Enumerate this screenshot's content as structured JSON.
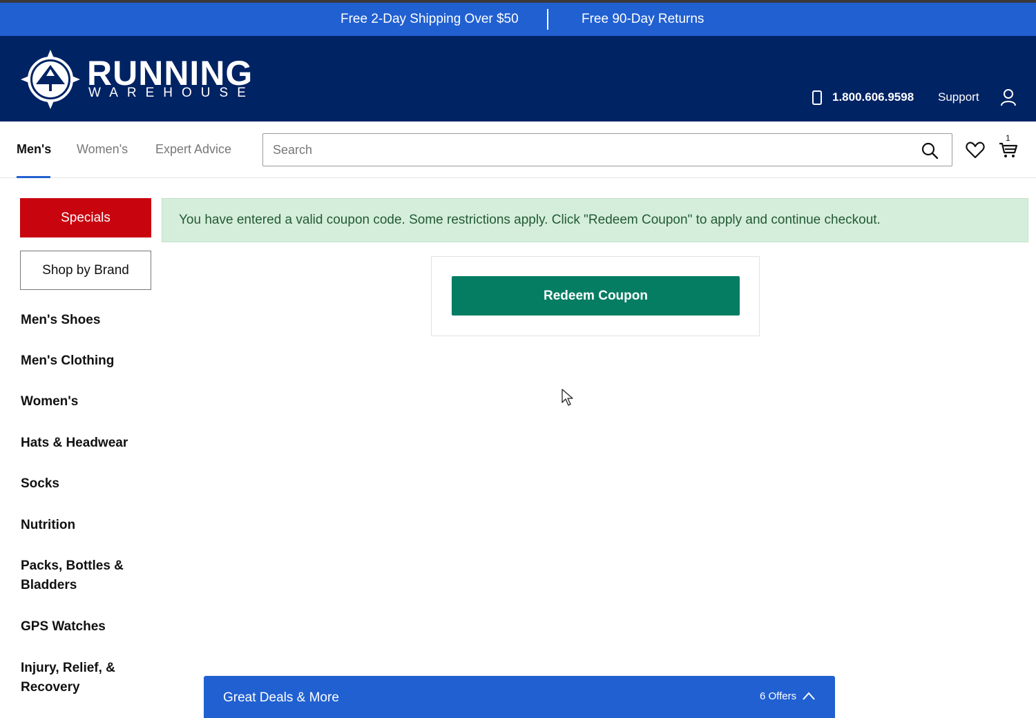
{
  "promo": {
    "left": "Free 2-Day Shipping Over $50",
    "right": "Free 90-Day Returns"
  },
  "header": {
    "logo_word": "RUNNING",
    "logo_sub": "WAREHOUSE",
    "phone": "1.800.606.9598",
    "support": "Support"
  },
  "nav": {
    "tabs": [
      {
        "label": "Men's",
        "active": true
      },
      {
        "label": "Women's",
        "active": false
      },
      {
        "label": "Expert Advice",
        "active": false
      }
    ],
    "search_placeholder": "Search",
    "cart_count": "1"
  },
  "sidebar": {
    "specials_label": "Specials",
    "brand_label": "Shop by Brand",
    "items": [
      {
        "label": "Men's Shoes"
      },
      {
        "label": "Men's Clothing"
      },
      {
        "label": "Women's"
      },
      {
        "label": "Hats & Headwear"
      },
      {
        "label": "Socks"
      },
      {
        "label": "Nutrition"
      },
      {
        "label": "Packs, Bottles & Bladders"
      },
      {
        "label": "GPS Watches"
      },
      {
        "label": "Injury, Relief, & Recovery"
      }
    ]
  },
  "main": {
    "alert_text": "You have entered a valid coupon code. Some restrictions apply. Click \"Redeem Coupon\" to apply and continue checkout.",
    "redeem_label": "Redeem Coupon"
  },
  "deals": {
    "title": "Great Deals & More",
    "count": "6 Offers"
  },
  "colors": {
    "promo_blue": "#2160d1",
    "header_navy": "#002364",
    "specials_red": "#c8040f",
    "redeem_green": "#057d63",
    "alert_bg": "#d5eedb"
  },
  "icons": [
    "logo-compass-icon",
    "phone-icon",
    "account-icon",
    "search-icon",
    "heart-icon",
    "cart-icon",
    "chevron-up-icon",
    "cursor-icon"
  ]
}
